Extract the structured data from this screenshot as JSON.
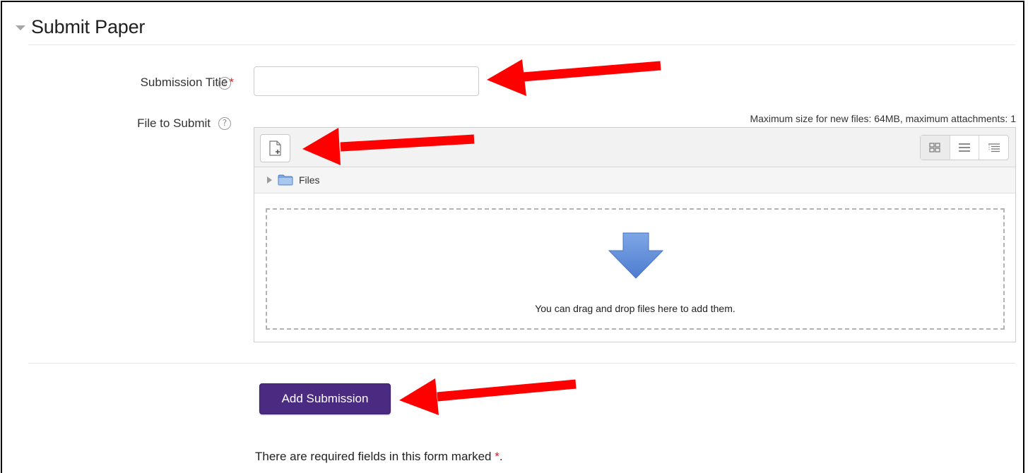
{
  "section": {
    "title": "Submit Paper"
  },
  "fields": {
    "submission_title": {
      "label": "Submission Title",
      "required_mark": "*",
      "value": "",
      "placeholder": ""
    },
    "file_to_submit": {
      "label": "File to Submit"
    }
  },
  "help_icon_glyph": "?",
  "filemanager": {
    "max_info": "Maximum size for new files: 64MB, maximum attachments: 1",
    "path_label": "Files",
    "drop_text": "You can drag and drop files here to add them.",
    "view_modes": [
      "icons-view-icon",
      "list-view-icon",
      "tree-view-icon"
    ]
  },
  "submit": {
    "label": "Add Submission"
  },
  "required_note": {
    "text": "There are required fields in this form marked ",
    "star": "*",
    "end": "."
  },
  "colors": {
    "primary_button": "#4b2b82",
    "required_star": "#e41b1b",
    "annotation_arrow": "#ff0000",
    "drop_arrow": "#5b8bd6"
  }
}
